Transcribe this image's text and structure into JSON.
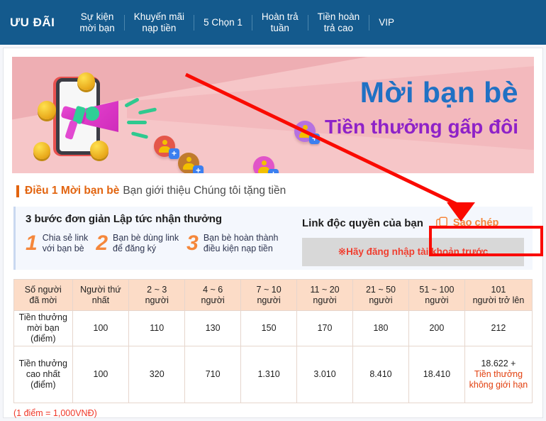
{
  "nav": {
    "brand": "ƯU ĐÃI",
    "items": [
      {
        "label": "Sự kiện\nmời bạn",
        "active": true,
        "name": "nav-su-kien-moi-ban"
      },
      {
        "label": "Khuyến mãi\nnạp tiền",
        "active": false,
        "name": "nav-khuyen-mai-nap-tien"
      },
      {
        "label": "5 Chọn 1",
        "active": false,
        "name": "nav-5-chon-1"
      },
      {
        "label": "Hoàn trả\ntuần",
        "active": false,
        "name": "nav-hoan-tra-tuan"
      },
      {
        "label": "Tiền hoàn\ntrả cao",
        "active": false,
        "name": "nav-tien-hoan-tra-cao"
      },
      {
        "label": "VIP",
        "active": false,
        "name": "nav-vip"
      }
    ],
    "bg_color": "#145a8d"
  },
  "banner": {
    "title": "Mời bạn bè",
    "subtitle": "Tiền thưởng gấp đôi",
    "title_color": "#2071c4",
    "subtitle_color": "#8e22c8",
    "bg_color": "#f0b8bb"
  },
  "section": {
    "strong": "Điều 1 Mời bạn bè",
    "rest": "Bạn giới thiệu Chúng tôi tặng tiền",
    "accent_color": "#e2640f"
  },
  "steps_panel": {
    "heading": "3 bước đơn giản Lập tức nhận thưởng",
    "steps": [
      {
        "num": "1",
        "text": "Chia sẻ link\nvới bạn bè"
      },
      {
        "num": "2",
        "text": "Bạn bè dùng link\nđể đăng ký"
      },
      {
        "num": "3",
        "text": "Bạn bè hoàn thành\nđiều kiện nạp tiền"
      }
    ],
    "link_label": "Link độc quyền của bạn",
    "copy_label": "Sao chép",
    "login_notice": "※Hãy đăng nhập tài khoản trước",
    "copy_color": "#f5873b",
    "notice_color": "#f03e2f"
  },
  "table": {
    "headers": [
      "Số người\nđã mời",
      "Người thứ\nnhất",
      "2 ~ 3\nngười",
      "4 ~ 6\nngười",
      "7 ~ 10\nngười",
      "11 ~ 20\nngười",
      "21 ~ 50\nngười",
      "51 ~ 100\nngười",
      "101\nngười trở lên"
    ],
    "rows": [
      {
        "label": "Tiền thưởng\nmời bạn\n(điểm)",
        "values": [
          "100",
          "110",
          "130",
          "150",
          "170",
          "180",
          "200",
          "212"
        ],
        "extra": ""
      },
      {
        "label": "Tiền thưởng\ncao nhất\n(điểm)",
        "values": [
          "100",
          "320",
          "710",
          "1.310",
          "3.010",
          "8.410",
          "18.410",
          "18.622 +"
        ],
        "extra": "Tiền thưởng\nkhông giới hạn"
      }
    ],
    "header_bg": "#fcdcc7"
  },
  "footnote": "(1 điểm = 1,000VNĐ)",
  "annotations": {
    "arrow_color": "#fa0a00",
    "highlight_target": "Sao chép"
  }
}
